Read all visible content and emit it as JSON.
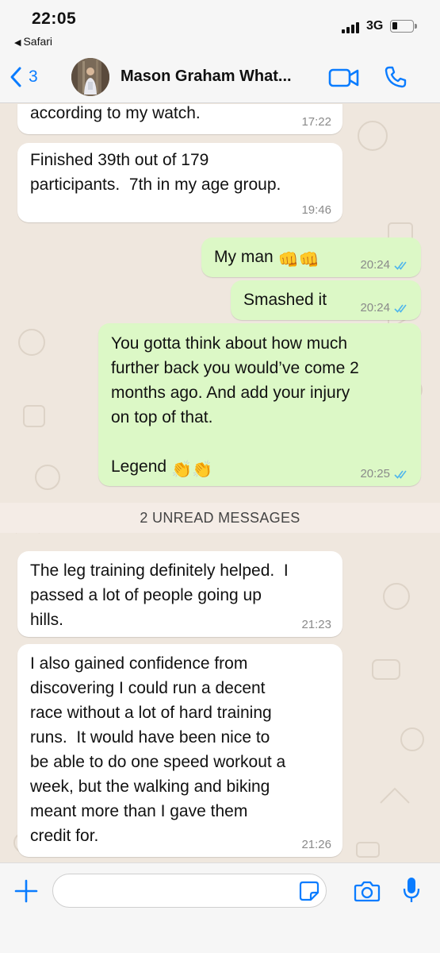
{
  "status_bar": {
    "time": "22:05",
    "back_app": "Safari",
    "network": "3G"
  },
  "header": {
    "back_count": "3",
    "contact_name": "Mason Graham What...",
    "avatar_icon": "avatar-photo",
    "video_icon": "video-camera-icon",
    "call_icon": "phone-icon"
  },
  "messages": [
    {
      "direction": "in",
      "text": "according to my watch.",
      "time": "17:22"
    },
    {
      "direction": "in",
      "text": "Finished 39th out of 179\nparticipants.  7th in my age group.",
      "time": "19:46"
    },
    {
      "direction": "out",
      "text": "My man",
      "emoji": "👊👊",
      "time": "20:24",
      "status": "read"
    },
    {
      "direction": "out",
      "text": "Smashed it",
      "time": "20:24",
      "status": "read"
    },
    {
      "direction": "out",
      "text": "You gotta think about how much\nfurther back you would’ve come 2\nmonths ago. And add your injury\non top of that.\n\nLegend",
      "emoji": "👏👏",
      "time": "20:25",
      "status": "read"
    },
    {
      "direction": "in",
      "text": "The leg training definitely helped.  I\npassed a lot of people going up\nhills.",
      "time": "21:23"
    },
    {
      "direction": "in",
      "text": "I also gained confidence from\ndiscovering I could run a decent\nrace without a lot of hard training\nruns.  It would have been nice to\nbe able to do one speed workout a\nweek, but the walking and biking\nmeant more than I gave them\ncredit for.",
      "time": "21:26"
    }
  ],
  "unread_divider": "2 UNREAD MESSAGES",
  "input_bar": {
    "placeholder": "",
    "icons": [
      "plus-icon",
      "sticker-icon",
      "camera-icon",
      "microphone-icon"
    ]
  },
  "colors": {
    "accent": "#0a7cff",
    "outgoing_bubble": "#dcf8c6",
    "incoming_bubble": "#ffffff",
    "chat_background": "#efe7de",
    "read_ticks": "#4fb6ec"
  }
}
